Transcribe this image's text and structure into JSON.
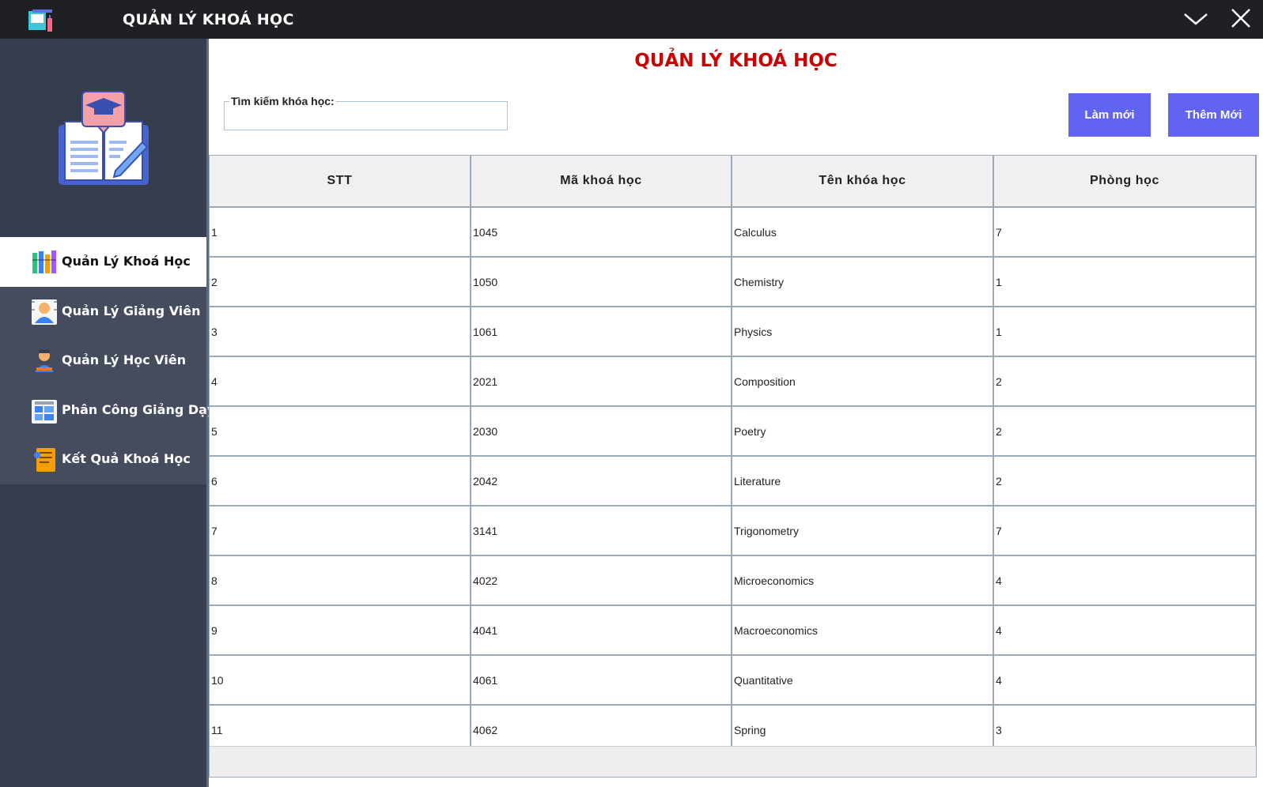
{
  "window": {
    "title": "QUẢN LÝ KHOÁ HỌC",
    "app_icon": "app-icon",
    "minimize_icon": "chevron-down-icon",
    "close_icon": "close-icon"
  },
  "sidebar": {
    "logo": "book-graduation-icon",
    "items": [
      {
        "label": "Quản Lý Khoá Học",
        "icon": "books-icon",
        "active": true
      },
      {
        "label": "Quản Lý Giảng Viên",
        "icon": "teacher-icon",
        "active": false
      },
      {
        "label": "Quản Lý Học Viên",
        "icon": "student-icon",
        "active": false
      },
      {
        "label": "Phân Công Giảng Dạy",
        "icon": "schedule-icon",
        "active": false
      },
      {
        "label": "Kết Quả Khoá Học",
        "icon": "report-icon",
        "active": false
      }
    ]
  },
  "main": {
    "title": "QUẢN LÝ KHOÁ HỌC",
    "search": {
      "label": "Tìm kiếm khóa học:",
      "value": "",
      "placeholder": ""
    },
    "buttons": {
      "refresh": "Làm mới",
      "add_new": "Thêm Mới"
    },
    "table": {
      "columns": [
        "STT",
        "Mã khoá học",
        "Tên khóa học",
        "Phòng học"
      ],
      "rows": [
        [
          "1",
          "1045",
          "Calculus",
          "7"
        ],
        [
          "2",
          "1050",
          "Chemistry",
          "1"
        ],
        [
          "3",
          "1061",
          "Physics",
          "1"
        ],
        [
          "4",
          "2021",
          "Composition",
          "2"
        ],
        [
          "5",
          "2030",
          "Poetry",
          "2"
        ],
        [
          "6",
          "2042",
          "Literature",
          "2"
        ],
        [
          "7",
          "3141",
          "Trigonometry",
          "7"
        ],
        [
          "8",
          "4022",
          "Microeconomics",
          "4"
        ],
        [
          "9",
          "4041",
          "Macroeconomics",
          "4"
        ],
        [
          "10",
          "4061",
          "Quantitative",
          "4"
        ],
        [
          "11",
          "4062",
          "Spring",
          "3"
        ]
      ]
    }
  },
  "colors": {
    "titlebar": "#1f2024",
    "sidebar": "#363d4f",
    "menu": "#444c5e",
    "title_red": "#cc0000",
    "button": "#6163f2"
  }
}
